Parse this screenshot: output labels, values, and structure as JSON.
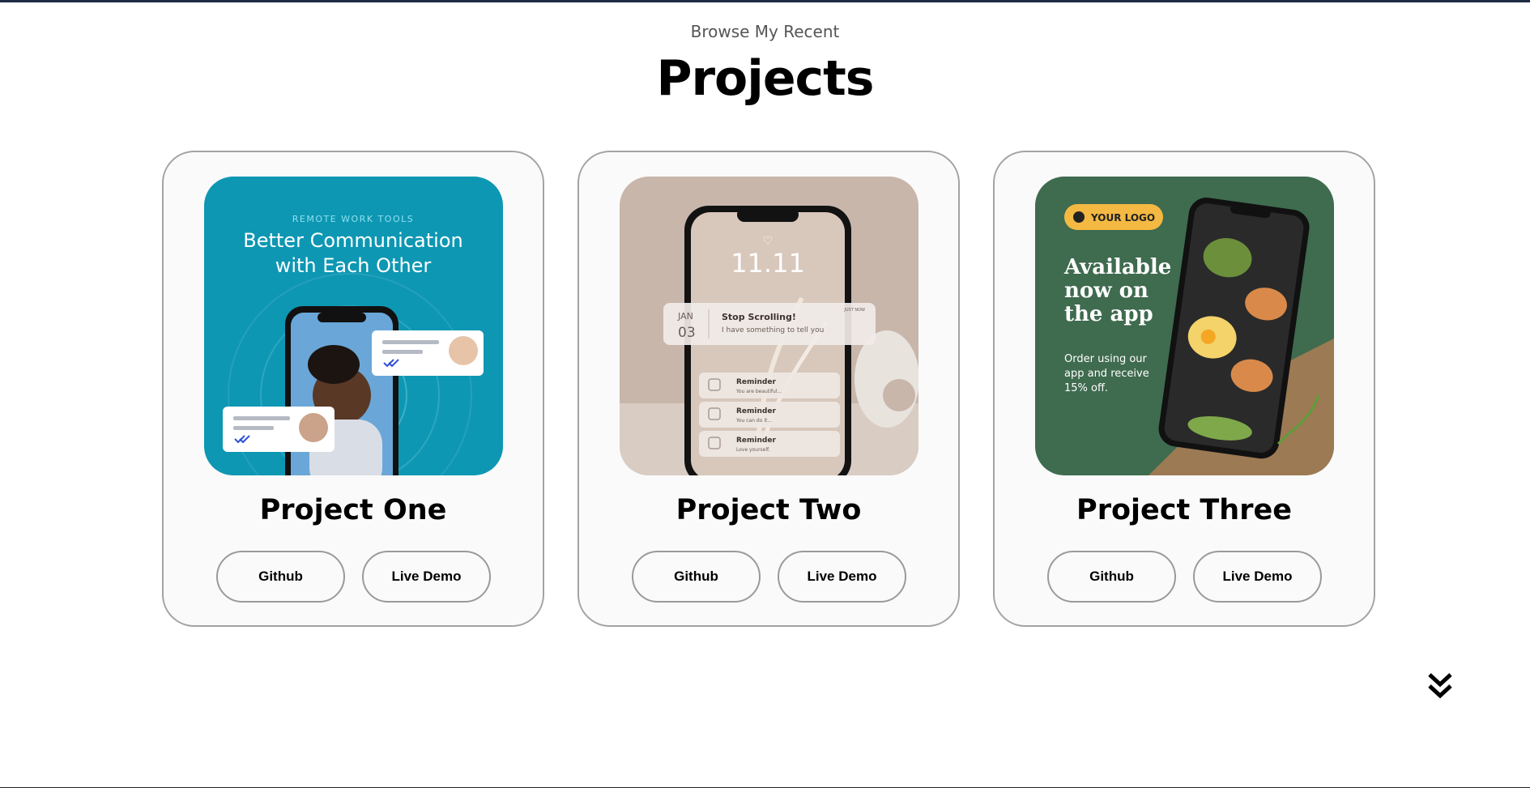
{
  "header": {
    "eyebrow": "Browse My Recent",
    "title": "Projects"
  },
  "projects": [
    {
      "title": "Project One",
      "github_label": "Github",
      "demo_label": "Live Demo",
      "thumbnail": {
        "kicker": "REMOTE WORK TOOLS",
        "headline_line1": "Better Communication",
        "headline_line2": "with Each Other",
        "bg_color": "#0d97b3"
      }
    },
    {
      "title": "Project Two",
      "github_label": "Github",
      "demo_label": "Live Demo",
      "thumbnail": {
        "time": "11.11",
        "date_month": "JAN",
        "date_day": "03",
        "notification_title": "Stop Scrolling!",
        "notification_body": "I have something to tell you",
        "notification_time": "JUST NOW",
        "reminders": [
          {
            "title": "Reminder",
            "body": "You are beautiful..."
          },
          {
            "title": "Reminder",
            "body": "You can do it..."
          },
          {
            "title": "Reminder",
            "body": "Love yourself."
          }
        ],
        "bg_color": "#c8b6ab"
      }
    },
    {
      "title": "Project Three",
      "github_label": "Github",
      "demo_label": "Live Demo",
      "thumbnail": {
        "logo_text": "YOUR LOGO",
        "headline_line1": "Available",
        "headline_line2": "now on",
        "headline_line3": "the app",
        "body_line1": "Order using our",
        "body_line2": "app and receive",
        "body_line3": "15% off.",
        "bg_color": "#3f6b4f",
        "logo_color": "#f4b942"
      }
    }
  ],
  "scroll": {
    "icon": "double-chevron-down-icon"
  }
}
